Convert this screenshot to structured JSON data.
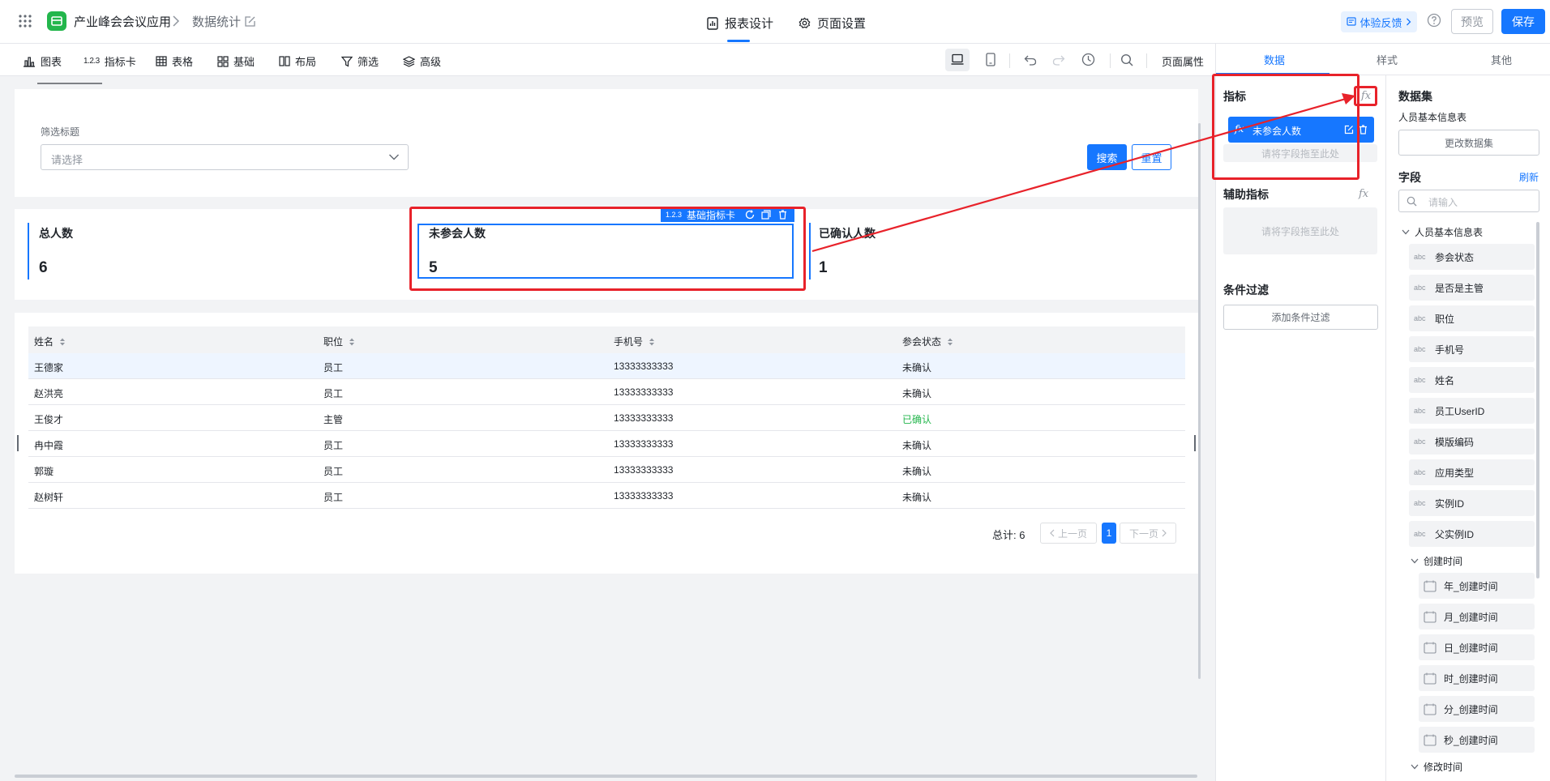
{
  "header": {
    "app_name": "产业峰会会议应用",
    "page_name": "数据统计",
    "tabs": [
      {
        "label": "报表设计",
        "active": true
      },
      {
        "label": "页面设置",
        "active": false
      }
    ],
    "feedback_label": "体验反馈",
    "preview_label": "预览",
    "save_label": "保存"
  },
  "toolbar": {
    "items": [
      "图表",
      "指标卡",
      "表格",
      "基础",
      "布局",
      "筛选",
      "高级"
    ],
    "page_props_label": "页面属性"
  },
  "filter": {
    "title": "筛选标题",
    "placeholder": "请选择",
    "search_label": "搜索",
    "reset_label": "重置"
  },
  "kpis": [
    {
      "title": "总人数",
      "value": "6"
    },
    {
      "title": "未参会人数",
      "value": "5"
    },
    {
      "title": "已确认人数",
      "value": "1"
    }
  ],
  "selection_toolbar": {
    "label": "基础指标卡",
    "icon": "123-icon"
  },
  "table": {
    "columns": [
      "姓名",
      "职位",
      "手机号",
      "参会状态"
    ],
    "rows": [
      [
        "王德家",
        "员工",
        "13333333333",
        "未确认"
      ],
      [
        "赵洪亮",
        "员工",
        "13333333333",
        "未确认"
      ],
      [
        "王俊才",
        "主管",
        "13333333333",
        "已确认"
      ],
      [
        "冉中霞",
        "员工",
        "13333333333",
        "未确认"
      ],
      [
        "郭璇",
        "员工",
        "13333333333",
        "未确认"
      ],
      [
        "赵树轩",
        "员工",
        "13333333333",
        "未确认"
      ]
    ],
    "confirmed_color": "#23b64c",
    "total_label": "总计: 6",
    "prev_label": "上一页",
    "next_label": "下一页",
    "current_page": "1"
  },
  "right_panel": {
    "tabs": [
      "数据",
      "样式",
      "其他"
    ],
    "metric_title": "指标",
    "metric_pill": "未参会人数",
    "drop_hint": "请将字段拖至此处",
    "aux_title": "辅助指标",
    "filter_title": "条件过滤",
    "add_filter": "添加条件过滤",
    "dataset_title": "数据集",
    "dataset_name": "人员基本信息表",
    "change_dataset": "更改数据集",
    "fields_title": "字段",
    "refresh": "刷新",
    "field_search_placeholder": "请输入",
    "tree_root": "人员基本信息表",
    "fields": [
      "参会状态",
      "是否是主管",
      "职位",
      "手机号",
      "姓名",
      "员工UserID",
      "模版编码",
      "应用类型",
      "实例ID",
      "父实例ID"
    ],
    "field_type_label": "abc",
    "created_group": "创建时间",
    "date_fields": [
      "年_创建时间",
      "月_创建时间",
      "日_创建时间",
      "时_创建时间",
      "分_创建时间",
      "秒_创建时间"
    ],
    "modified_group": "修改时间"
  },
  "colors": {
    "accent": "#1677ff",
    "annotation_red": "#e8222a",
    "app_green": "#23b64c"
  }
}
